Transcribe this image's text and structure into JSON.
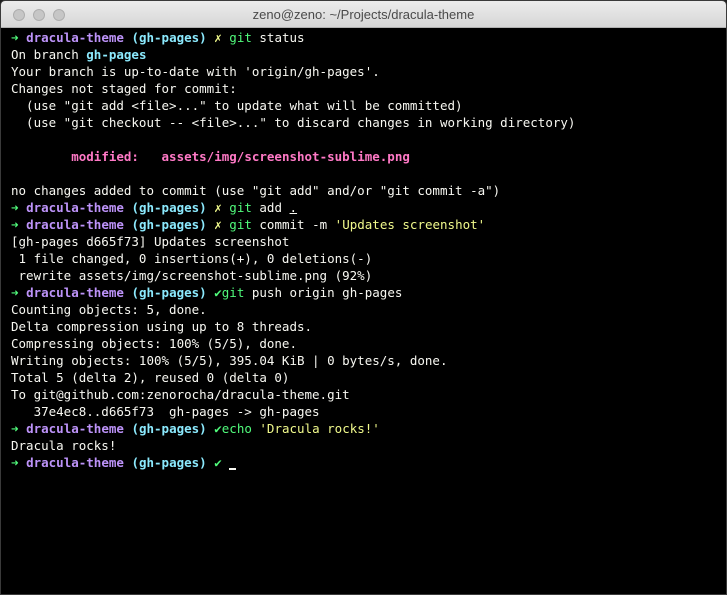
{
  "window": {
    "title": "zeno@zeno: ~/Projects/dracula-theme"
  },
  "prompt": {
    "arrow": "➜",
    "dir": "dracula-theme",
    "branch": "(gh-pages)",
    "fail_mark": "✗",
    "ok_mark": "✔"
  },
  "colors": {
    "background": "#000000",
    "foreground": "#f8f8f2",
    "green": "#50fa7b",
    "purple": "#bd93f9",
    "cyan": "#8be9fd",
    "yellow": "#f1fa8c",
    "pink": "#ff79c6"
  },
  "terminal": {
    "cmd1": {
      "cmd": "git",
      "args": "status"
    },
    "status": {
      "on_branch_prefix": "On branch ",
      "branch": "gh-pages",
      "up_to_date": "Your branch is up-to-date with 'origin/gh-pages'.",
      "changes_header": "Changes not staged for commit:",
      "hint1": "  (use \"git add <file>...\" to update what will be committed)",
      "hint2": "  (use \"git checkout -- <file>...\" to discard changes in working directory)",
      "modified_label": "modified:",
      "modified_file": "assets/img/screenshot-sublime.png",
      "no_changes": "no changes added to commit (use \"git add\" and/or \"git commit -a\")"
    },
    "cmd2": {
      "cmd": "git",
      "args": "add",
      "target": "."
    },
    "cmd3": {
      "cmd": "git",
      "args": "commit -m",
      "message": "'Updates screenshot'"
    },
    "commit": {
      "l1": "[gh-pages d665f73] Updates screenshot",
      "l2": " 1 file changed, 0 insertions(+), 0 deletions(-)",
      "l3": " rewrite assets/img/screenshot-sublime.png (92%)"
    },
    "cmd4": {
      "cmd": "git",
      "args": "push origin gh-pages"
    },
    "push": {
      "l1": "Counting objects: 5, done.",
      "l2": "Delta compression using up to 8 threads.",
      "l3": "Compressing objects: 100% (5/5), done.",
      "l4": "Writing objects: 100% (5/5), 395.04 KiB | 0 bytes/s, done.",
      "l5": "Total 5 (delta 2), reused 0 (delta 0)",
      "l6": "To git@github.com:zenorocha/dracula-theme.git",
      "l7": "   37e4ec8..d665f73  gh-pages -> gh-pages"
    },
    "cmd5": {
      "cmd": "echo",
      "args": "'Dracula rocks!'"
    },
    "echo_output": "Dracula rocks!"
  }
}
